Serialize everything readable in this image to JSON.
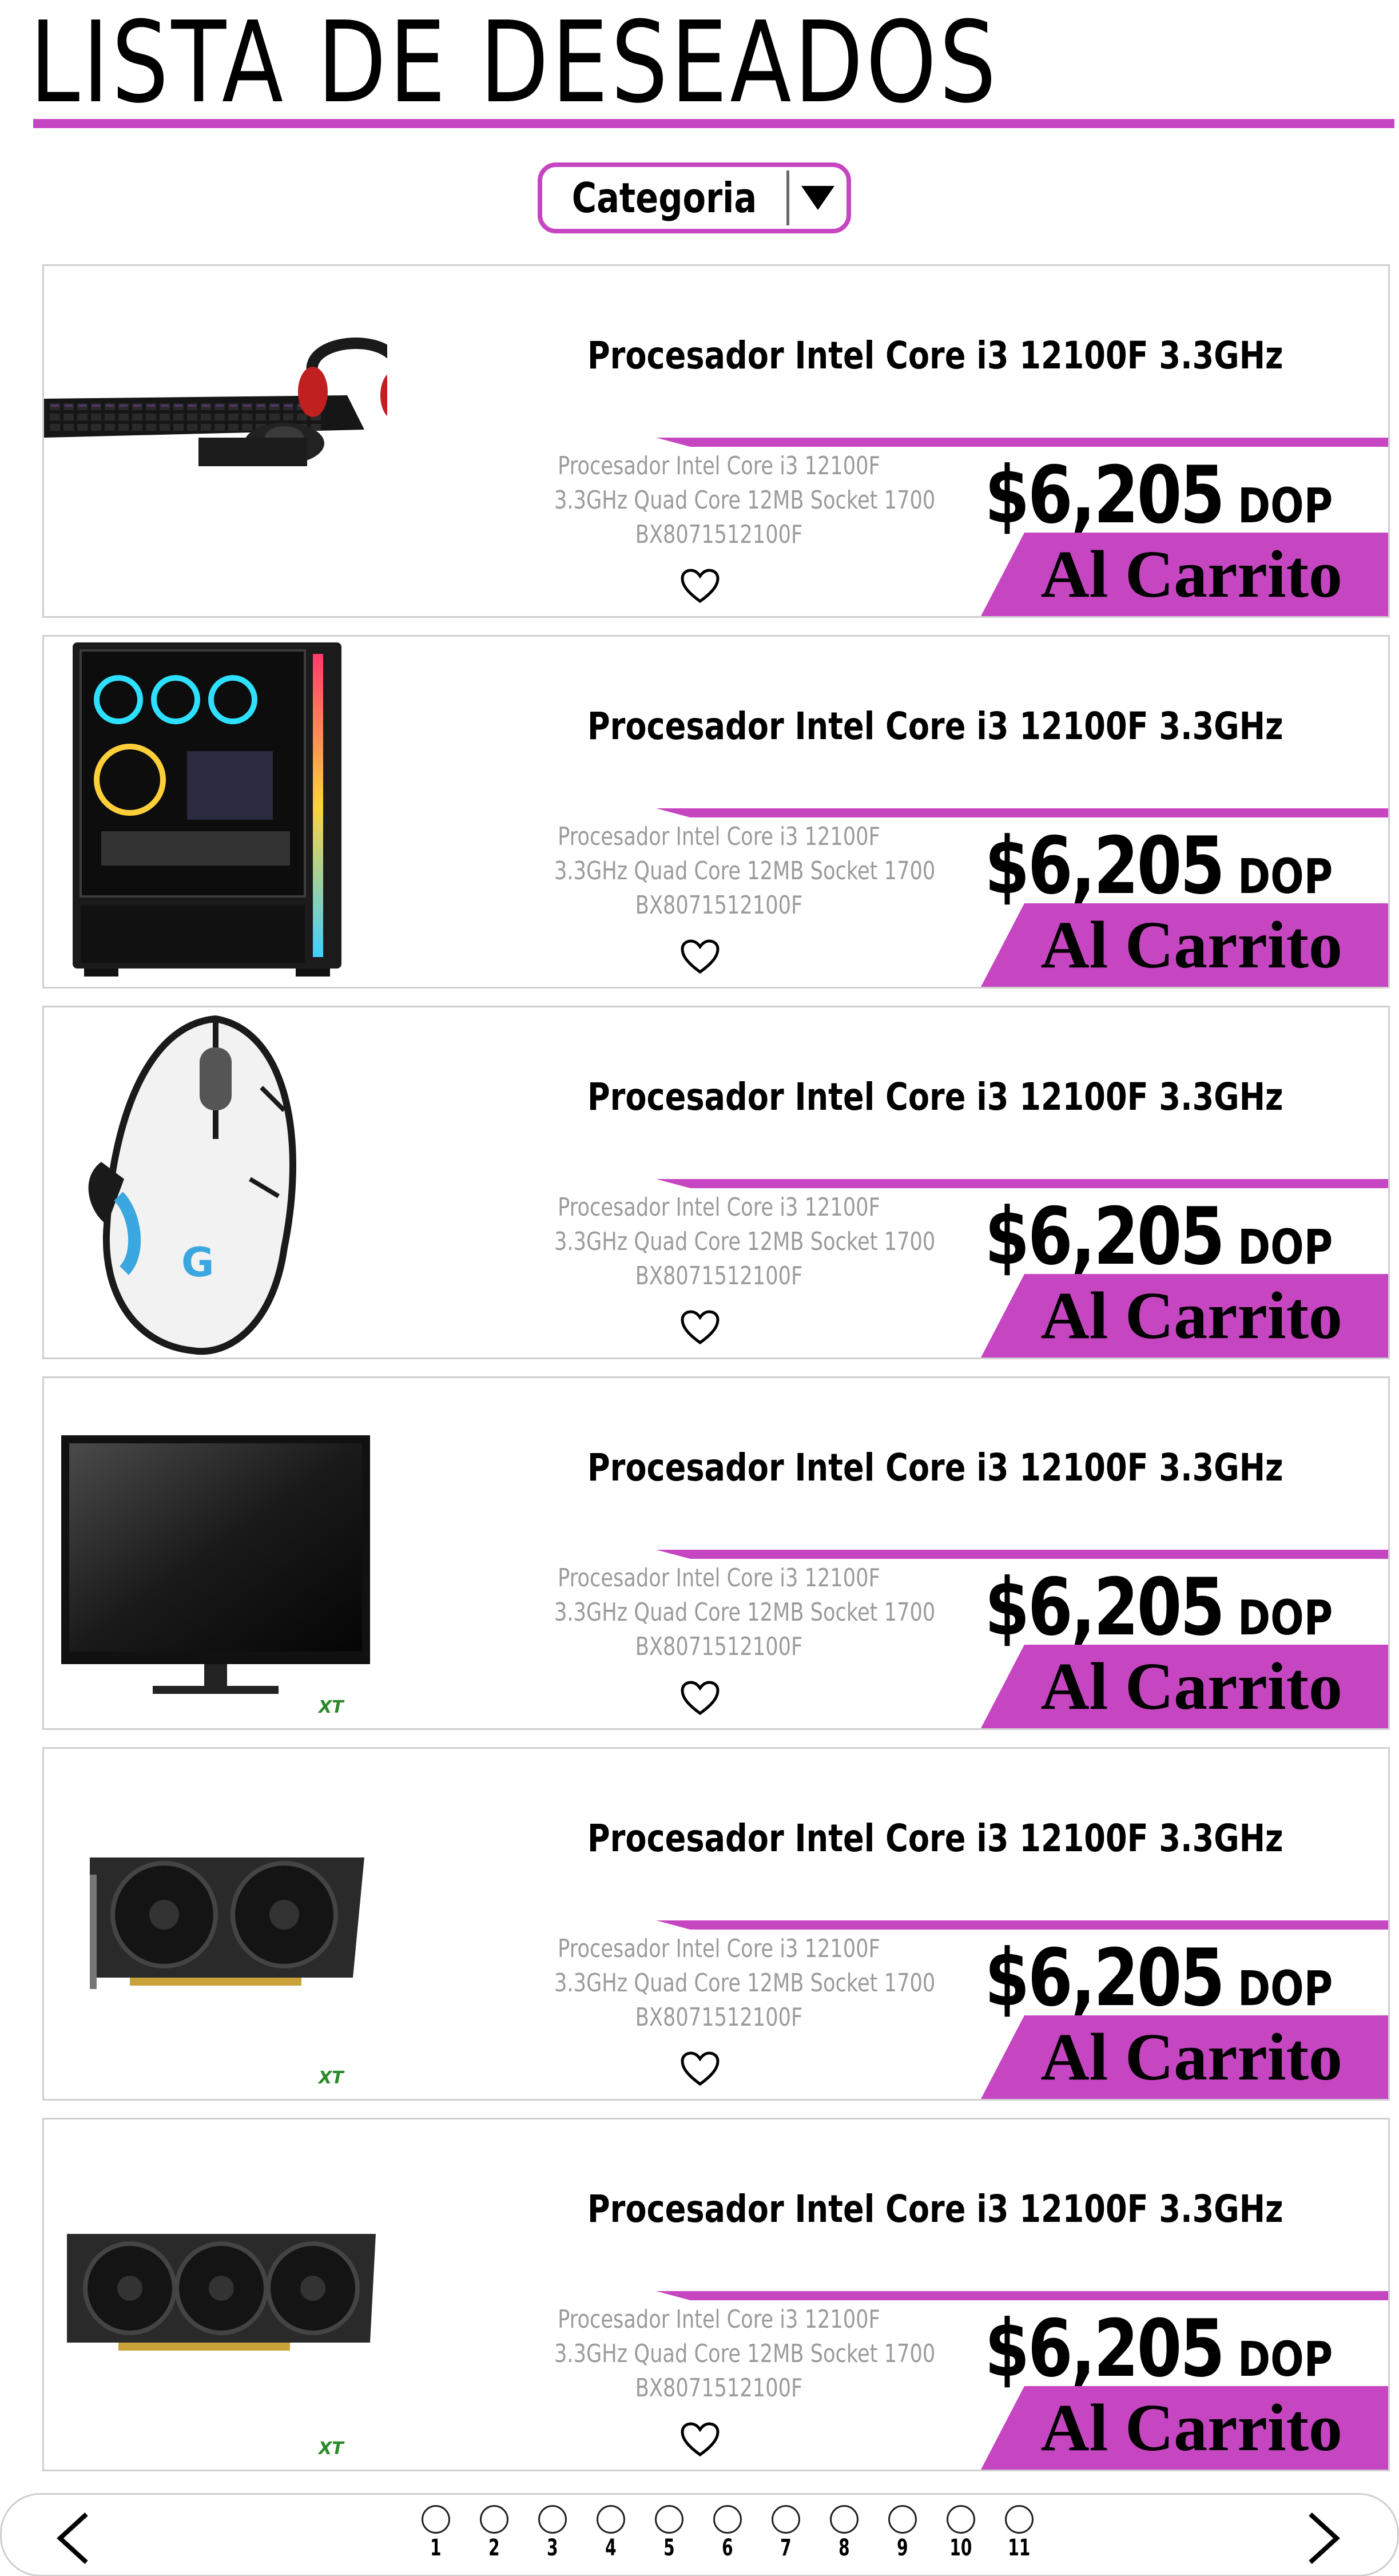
{
  "page": {
    "title": "LISTA DE DESEADOS",
    "accent_color": "#c646c1"
  },
  "filter": {
    "label": "Categoria",
    "icon": "caret-down-icon"
  },
  "products": [
    {
      "image": "keyboard-mouse-headset-combo",
      "name": "Procesador Intel Core i3 12100F 3.3GHz",
      "desc_lines": [
        "Procesador Intel Core i3 12100F",
        "3.3GHz Quad Core 12MB Socket 1700",
        "BX8071512100F"
      ],
      "price": "$6,205",
      "currency": "DOP",
      "cart_label": "Al Carrito",
      "favorite_icon": "heart-outline-icon"
    },
    {
      "image": "gaming-pc-case-rgb",
      "name": "Procesador Intel Core i3 12100F 3.3GHz",
      "desc_lines": [
        "Procesador Intel Core i3 12100F",
        "3.3GHz Quad Core 12MB Socket 1700",
        "BX8071512100F"
      ],
      "price": "$6,205",
      "currency": "DOP",
      "cart_label": "Al Carrito",
      "favorite_icon": "heart-outline-icon"
    },
    {
      "image": "gaming-mouse",
      "name": "Procesador Intel Core i3 12100F 3.3GHz",
      "desc_lines": [
        "Procesador Intel Core i3 12100F",
        "3.3GHz Quad Core 12MB Socket 1700",
        "BX8071512100F"
      ],
      "price": "$6,205",
      "currency": "DOP",
      "cart_label": "Al Carrito",
      "favorite_icon": "heart-outline-icon"
    },
    {
      "image": "monitor",
      "name": "Procesador Intel Core i3 12100F 3.3GHz",
      "desc_lines": [
        "Procesador Intel Core i3 12100F",
        "3.3GHz Quad Core 12MB Socket 1700",
        "BX8071512100F"
      ],
      "price": "$6,205",
      "currency": "DOP",
      "cart_label": "Al Carrito",
      "favorite_icon": "heart-outline-icon"
    },
    {
      "image": "graphics-card-dual-fan",
      "name": "Procesador Intel Core i3 12100F 3.3GHz",
      "desc_lines": [
        "Procesador Intel Core i3 12100F",
        "3.3GHz Quad Core 12MB Socket 1700",
        "BX8071512100F"
      ],
      "price": "$6,205",
      "currency": "DOP",
      "cart_label": "Al Carrito",
      "favorite_icon": "heart-outline-icon"
    },
    {
      "image": "graphics-card-triple-fan",
      "name": "Procesador Intel Core i3 12100F 3.3GHz",
      "desc_lines": [
        "Procesador Intel Core i3 12100F",
        "3.3GHz Quad Core 12MB Socket 1700",
        "BX8071512100F"
      ],
      "price": "$6,205",
      "currency": "DOP",
      "cart_label": "Al Carrito",
      "favorite_icon": "heart-outline-icon"
    }
  ],
  "pagination": {
    "prev_icon": "chevron-left-icon",
    "next_icon": "chevron-right-icon",
    "pages": [
      "1",
      "2",
      "3",
      "4",
      "5",
      "6",
      "7",
      "8",
      "9",
      "10",
      "11"
    ]
  }
}
